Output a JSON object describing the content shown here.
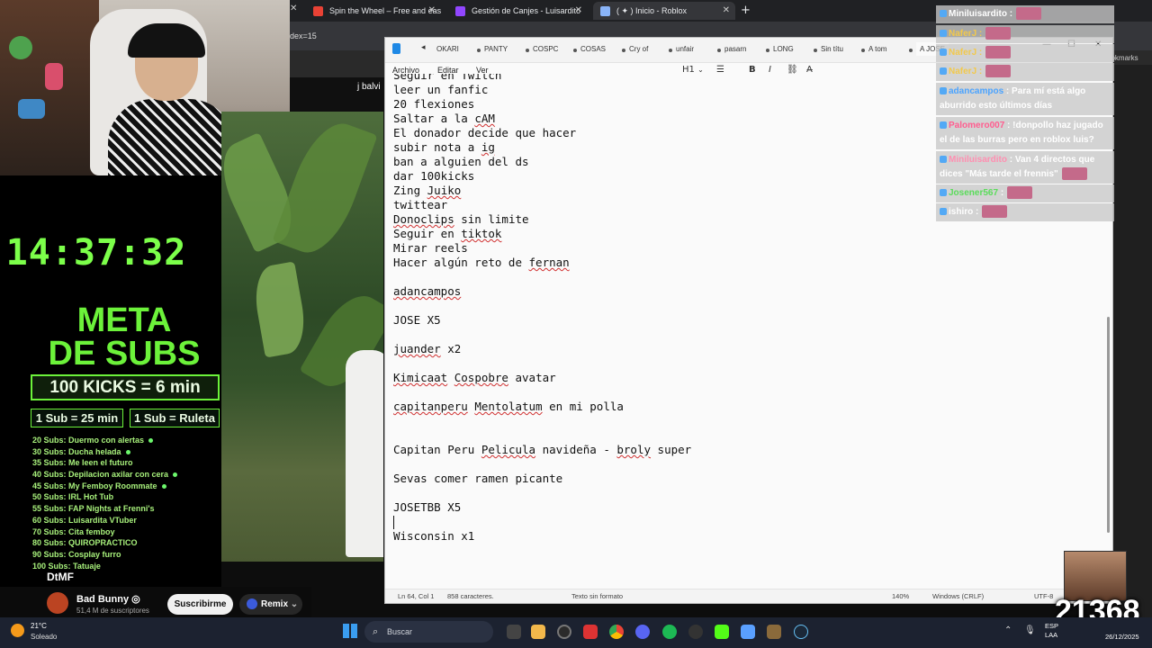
{
  "browser": {
    "tabs": [
      {
        "label": "Spin the Wheel – Free and easy",
        "favicon_color": "#e94235"
      },
      {
        "label": "Gestión de Canjes - Luisardito ",
        "favicon_color": "#9146ff"
      },
      {
        "label": "( ✦ ) Inicio - Roblox",
        "favicon_color": "#8ab4f8"
      }
    ],
    "new_tab": "+",
    "url_fragment": "dex=15",
    "bookmarks_label": "ookmarks"
  },
  "video": {
    "top_label": "j balvi"
  },
  "overlay": {
    "timer": "14:37:32",
    "meta_line1": "META",
    "meta_line2": "DE SUBS",
    "kicks": "100 KICKS = 6 min",
    "sub_time": "1 Sub = 25 min",
    "sub_wheel": "1 Sub = Ruleta",
    "goals": [
      {
        "text": "20 Subs: Duermo con alertas",
        "done": true
      },
      {
        "text": "30 Subs: Ducha helada",
        "done": true
      },
      {
        "text": "35 Subs: Me leen el futuro",
        "done": false
      },
      {
        "text": "40 Subs: Depilacion axilar con cera",
        "done": true
      },
      {
        "text": "45 Subs: My Femboy Roommate",
        "done": true
      },
      {
        "text": "50 Subs: IRL Hot Tub",
        "done": false
      },
      {
        "text": "55 Subs: FAP Nights at Frenni's",
        "done": false
      },
      {
        "text": "60 Subs: Luisardita VTuber",
        "done": false
      },
      {
        "text": "70 Subs: Cita femboy",
        "done": false
      },
      {
        "text": "80 Subs: QUIROPRACTICO",
        "done": false
      },
      {
        "text": "90 Subs: Cosplay furro",
        "done": false
      },
      {
        "text": "100 Subs: Tatuaje",
        "done": false
      }
    ],
    "footer": "DtMF",
    "sub_counter": "21368"
  },
  "youtube": {
    "channel_name": "Bad Bunny ◎",
    "channel_subs": "51,4 M de suscriptores",
    "subscribe_label": "Suscribirme",
    "remix_label": "Remix"
  },
  "notepad": {
    "tabs": [
      "OKARI",
      "PANTY",
      "COSPC",
      "COSAS",
      "Cry of",
      "unfair",
      "pasarn",
      "LONG",
      "Sin títu",
      "A tom",
      "A JOSE"
    ],
    "menu": [
      "Archivo",
      "Editar",
      "Ver"
    ],
    "heading_tool": "H1",
    "lines": [
      [
        {
          "t": "Seguir en Twitch",
          "u": false
        }
      ],
      [
        {
          "t": "leer un fanfic",
          "u": false
        }
      ],
      [
        {
          "t": "20 flexiones",
          "u": false
        }
      ],
      [
        {
          "t": "Saltar a la ",
          "u": false
        },
        {
          "t": "cAM",
          "u": true
        }
      ],
      [
        {
          "t": "El donador decide que hacer",
          "u": false
        }
      ],
      [
        {
          "t": "subir nota a ",
          "u": false
        },
        {
          "t": "ig",
          "u": true
        }
      ],
      [
        {
          "t": "ban a alguien del ds",
          "u": false
        }
      ],
      [
        {
          "t": "dar 100kicks",
          "u": false
        }
      ],
      [
        {
          "t": "Zing ",
          "u": false
        },
        {
          "t": "Juiko",
          "u": true
        }
      ],
      [
        {
          "t": "twittear",
          "u": false
        }
      ],
      [
        {
          "t": "Donoclips",
          "u": true
        },
        {
          "t": " sin limite",
          "u": false
        }
      ],
      [
        {
          "t": "Seguir en ",
          "u": false
        },
        {
          "t": "tiktok",
          "u": true
        }
      ],
      [
        {
          "t": "Mirar reels",
          "u": false
        }
      ],
      [
        {
          "t": "Hacer algún reto de ",
          "u": false
        },
        {
          "t": "fernan",
          "u": true
        }
      ],
      [],
      [
        {
          "t": "adancampos",
          "u": true
        }
      ],
      [],
      [
        {
          "t": "JOSE X5",
          "u": false
        }
      ],
      [],
      [
        {
          "t": "juander",
          "u": true
        },
        {
          "t": " x2",
          "u": false
        }
      ],
      [],
      [
        {
          "t": "Kimicaat",
          "u": true
        },
        {
          "t": " ",
          "u": false
        },
        {
          "t": "Cospobre",
          "u": true
        },
        {
          "t": " avatar",
          "u": false
        }
      ],
      [],
      [
        {
          "t": "capitanperu",
          "u": true
        },
        {
          "t": " ",
          "u": false
        },
        {
          "t": "Mentolatum",
          "u": true
        },
        {
          "t": " en mi polla",
          "u": false
        }
      ],
      [],
      [],
      [
        {
          "t": "Capitan Peru ",
          "u": false
        },
        {
          "t": "Pelicula",
          "u": true
        },
        {
          "t": " navideña - ",
          "u": false
        },
        {
          "t": "broly",
          "u": true
        },
        {
          "t": " super",
          "u": false
        }
      ],
      [],
      [
        {
          "t": "Sevas comer ramen picante",
          "u": false
        }
      ],
      [],
      [
        {
          "t": "JOSETBB X5",
          "u": false
        }
      ],
      [],
      [
        {
          "t": "Wisconsin x1",
          "u": false
        }
      ]
    ],
    "status": {
      "position": "Ln 64, Col 1",
      "chars": "858 caracteres.",
      "format": "Texto sin formato",
      "zoom": "140%",
      "eol": "Windows (CRLF)",
      "encoding": "UTF-8"
    }
  },
  "chat": [
    {
      "name": "Miniluisardito :",
      "name_color": "#ffffff",
      "text": "",
      "emote": true
    },
    {
      "name": "NaferJ :",
      "name_color": "#f2c94c",
      "text": "",
      "emote": true
    },
    {
      "name": "NaferJ :",
      "name_color": "#f2c94c",
      "text": "",
      "emote": true
    },
    {
      "name": "NaferJ :",
      "name_color": "#f2c94c",
      "text": "",
      "emote": true
    },
    {
      "name": "adancampos",
      "name_color": "#4aa3ff",
      "text": " : Para mí está algo aburrido esto últimos días",
      "emote": false
    },
    {
      "name": "Palomero007",
      "name_color": "#ff5d8f",
      "text": " : !donpollo haz jugado el de las burras pero en roblox luis?",
      "emote": false
    },
    {
      "name": "Miniluisardito",
      "name_color": "#ff8fb1",
      "text": " : Van 4 directos que dices \"Más tarde el frennis\"",
      "emote": true
    },
    {
      "name": "Josener567",
      "name_color": "#5bdc5b",
      "text": " :",
      "emote": true
    },
    {
      "name": "ishiro :",
      "name_color": "#ffffff",
      "text": "",
      "emote": true
    }
  ],
  "taskbar": {
    "temp": "21°C",
    "weather": "Soleado",
    "search_placeholder": "Buscar",
    "lang_line1": "ESP",
    "lang_line2": "LAA",
    "date": "26/12/2025"
  }
}
